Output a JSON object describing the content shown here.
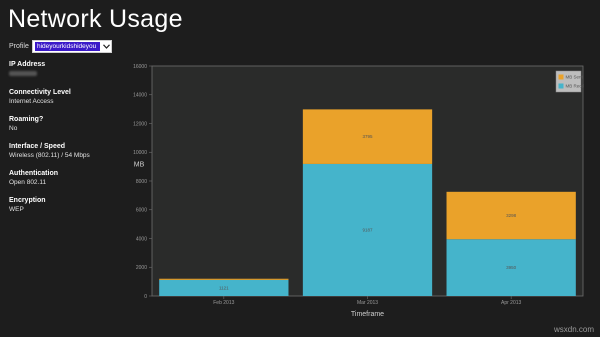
{
  "window": {
    "title": "Network Usage"
  },
  "profile": {
    "label": "Profile",
    "selected": "hideyourkidshideyou"
  },
  "info": [
    {
      "label": "IP Address",
      "value": "",
      "blurred": true
    },
    {
      "label": "Connectivity Level",
      "value": "Internet Access"
    },
    {
      "label": "Roaming?",
      "value": "No"
    },
    {
      "label": "Interface / Speed",
      "value": "Wireless (802.11) / 54 Mbps"
    },
    {
      "label": "Authentication",
      "value": "Open 802.11"
    },
    {
      "label": "Encryption",
      "value": "WEP"
    }
  ],
  "watermark": "wsxdn.com",
  "chart_data": {
    "type": "bar",
    "stacked": true,
    "categories": [
      "Feb 2013",
      "Mar 2013",
      "Apr 2013"
    ],
    "series": [
      {
        "name": "MB Recd",
        "values": [
          1121,
          9187,
          3950
        ],
        "color": "#45b4cb"
      },
      {
        "name": "MB Sent",
        "values": [
          80,
          3795,
          3298
        ],
        "color": "#eaa22a"
      }
    ],
    "data_labels": {
      "MB Recd": [
        "1121",
        "9187",
        "3950"
      ],
      "MB Sent": [
        "",
        "3795",
        "3298"
      ]
    },
    "ylabel": "MB",
    "xlabel": "Timeframe",
    "ylim": [
      0,
      16000
    ],
    "yticks": [
      "0",
      "2000",
      "4000",
      "6000",
      "8000",
      "10000",
      "12000",
      "14000",
      "16000"
    ],
    "legend_position": "top-right",
    "legend_order": [
      "MB Sent",
      "MB Recd"
    ],
    "grid": false,
    "background": "#2a2b2a"
  }
}
